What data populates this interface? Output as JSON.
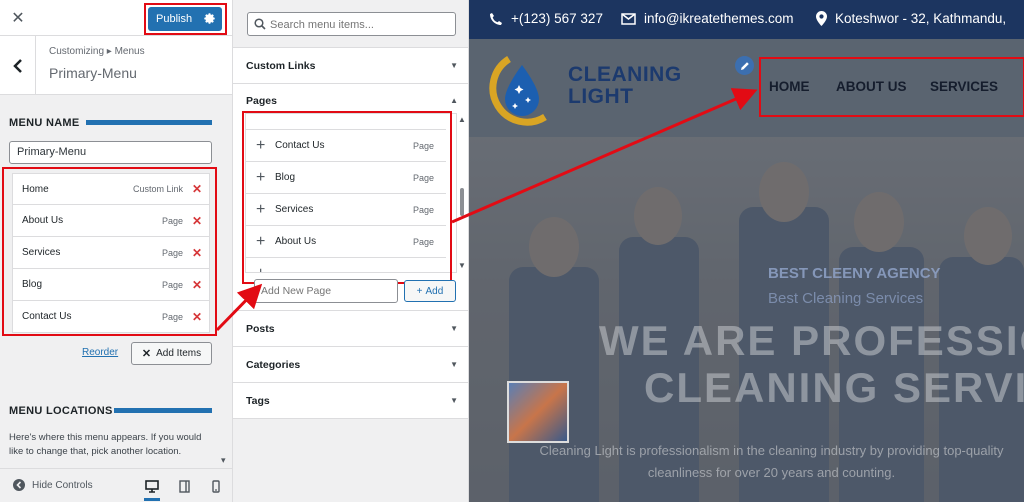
{
  "customizer": {
    "publish_label": "Publish",
    "breadcrumb": "Customizing ▸ Menus",
    "panel_title": "Primary-Menu",
    "menu_name_heading": "MENU NAME",
    "menu_name_value": "Primary-Menu",
    "menu_items": [
      {
        "label": "Home",
        "type": "Custom Link"
      },
      {
        "label": "About Us",
        "type": "Page"
      },
      {
        "label": "Services",
        "type": "Page"
      },
      {
        "label": "Blog",
        "type": "Page"
      },
      {
        "label": "Contact Us",
        "type": "Page"
      }
    ],
    "reorder_label": "Reorder",
    "add_items_label": "Add Items",
    "menu_locations_heading": "MENU LOCATIONS",
    "menu_locations_text": "Here's where this menu appears. If you would like to change that, pick another location.",
    "hide_controls_label": "Hide Controls"
  },
  "add_items": {
    "search_placeholder": "Search menu items...",
    "sections": {
      "custom_links": "Custom Links",
      "pages": "Pages",
      "posts": "Posts",
      "categories": "Categories",
      "tags": "Tags"
    },
    "pages": [
      {
        "label": "Contact Us",
        "type": "Page"
      },
      {
        "label": "Blog",
        "type": "Page"
      },
      {
        "label": "Services",
        "type": "Page"
      },
      {
        "label": "About Us",
        "type": "Page"
      }
    ],
    "new_page_placeholder": "Add New Page",
    "add_label": "Add"
  },
  "preview": {
    "phone": "+(123) 567 327",
    "email": "info@ikreatethemes.com",
    "address": "Koteshwor - 32, Kathmandu,",
    "logo_line1": "CLEANING",
    "logo_line2": "LIGHT",
    "nav": [
      "HOME",
      "ABOUT US",
      "SERVICES"
    ],
    "hero_tag": "BEST CLEENY AGENCY",
    "hero_sub": "Best Cleaning Services",
    "hero_title_line1": "WE ARE PROFESSIO",
    "hero_title_line2": "CLEANING SERVI",
    "hero_desc": "Cleaning Light is professionalism in the cleaning industry by providing top-quality cleanliness for over 20 years and counting."
  },
  "colors": {
    "accent": "#2271b1",
    "highlight": "#e20b14",
    "topbar": "#1c3560",
    "remove": "#d63638"
  }
}
